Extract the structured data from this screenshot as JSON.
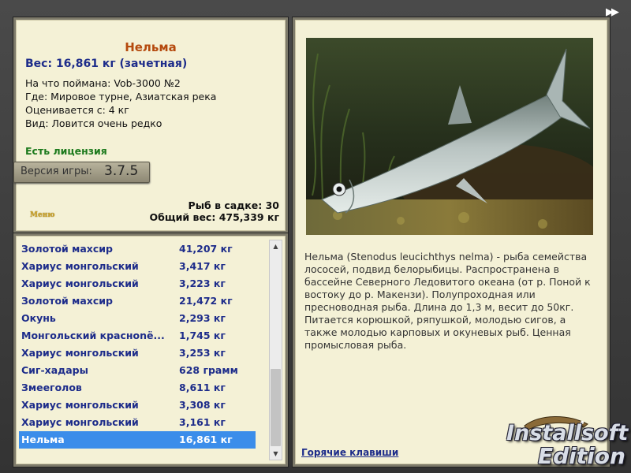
{
  "fish": {
    "name": "Нельма",
    "weight_line": "Вес: 16,861 кг (зачетная)",
    "caught_with": "На что поймана: Vob-3000 №2",
    "location": "Где: Мировое турне, Азиатская река",
    "valued_from": "Оценивается с: 4 кг",
    "rarity": "Вид: Ловится очень редко",
    "license": "Есть лицензия",
    "description": "Нельма (Stenodus leucichthys nelma) - рыба семейства лососей, подвид белорыбицы. Распространена в бассейне Северного Ледовитого океана (от р. Поной к востоку до р. Макензи). Полупроходная или пресноводная рыба. Длина до 1,3 м, весит до 50кг. Питается корюшкой, ряпушкой, молодью сигов, а также молодью карповых и окуневых рыб. Ценная промысловая рыба."
  },
  "version": {
    "label": "Версия игры:",
    "number": "3.7.5"
  },
  "menu": {
    "label": "Меню"
  },
  "stats": {
    "fish_in_keepnet": "Рыб в садке: 30",
    "total_weight": "Общий вес: 475,339 кг"
  },
  "catch_list": [
    {
      "name": "Золотой махсир",
      "weight": "41,207 кг"
    },
    {
      "name": "Хариус монгольский",
      "weight": "3,417 кг"
    },
    {
      "name": "Хариус монгольский",
      "weight": "3,223 кг"
    },
    {
      "name": "Золотой махсир",
      "weight": "21,472 кг"
    },
    {
      "name": "Окунь",
      "weight": "2,293 кг"
    },
    {
      "name": "Монгольский красноnё...",
      "weight": "1,745 кг"
    },
    {
      "name": "Хариус монгольский",
      "weight": "3,253 кг"
    },
    {
      "name": "Сиг-хадары",
      "weight": "628 грамм"
    },
    {
      "name": "Змееголов",
      "weight": "8,611 кг"
    },
    {
      "name": "Хариус монгольский",
      "weight": "3,308 кг"
    },
    {
      "name": "Хариус монгольский",
      "weight": "3,161 кг"
    },
    {
      "name": "Нельма",
      "weight": "16,861 кг",
      "selected": true
    }
  ],
  "hotkeys_link": "Горячие клавиши",
  "watermark": {
    "line1": "Installsoft",
    "line2": "Edition"
  },
  "colors": {
    "panel_bg": "#f4f1d6",
    "title_orange": "#b54a0e",
    "text_blue": "#1d2c8a",
    "license_green": "#1c7a1c",
    "selection_blue": "#3b8dea"
  },
  "icons": {
    "skip": "double-arrow-right-icon"
  }
}
